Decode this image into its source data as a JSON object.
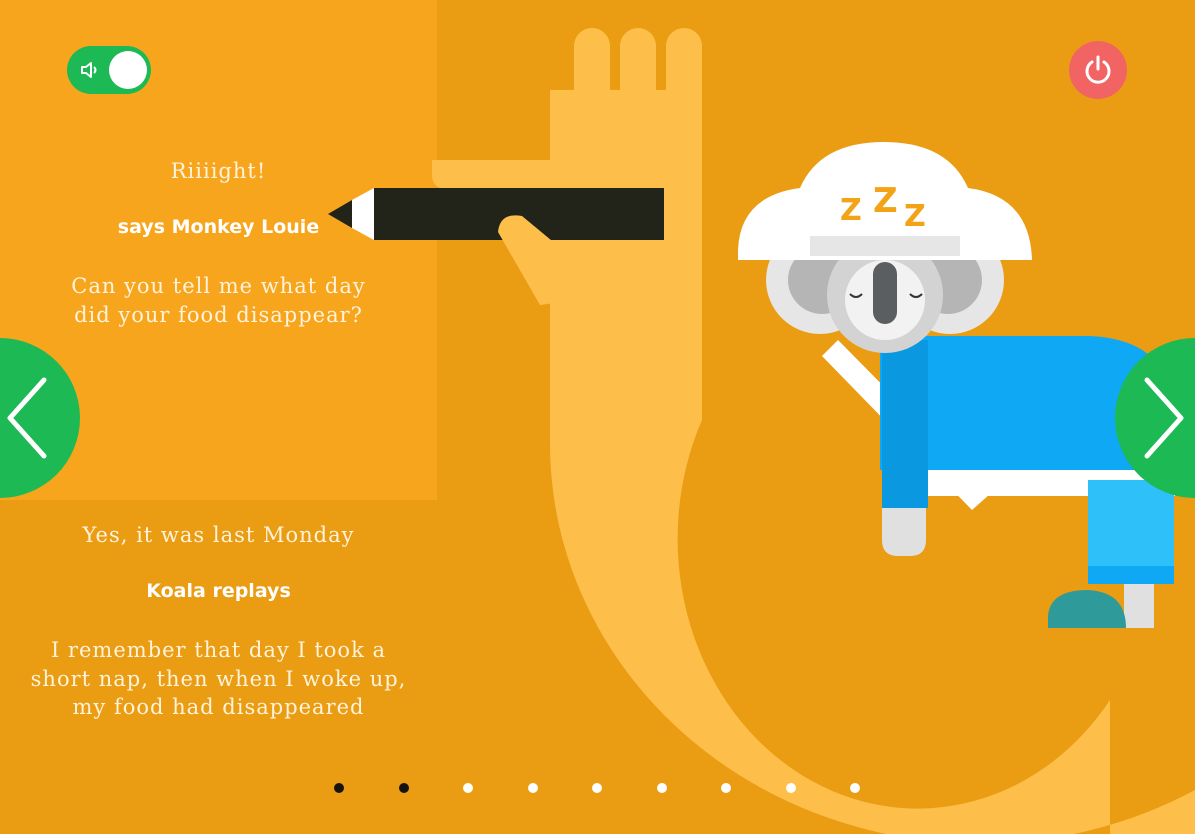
{
  "colors": {
    "background": "#EA9C13",
    "panel": "#F8A51E",
    "accent_green": "#1DB954",
    "power_red": "#F26464",
    "arm": "#FDBF4A",
    "shirt": "#0FA8F5",
    "active_dot": "#16130E"
  },
  "sound_toggle": {
    "icon": "speaker-icon",
    "state": "on"
  },
  "power_button": {
    "icon": "power-icon"
  },
  "monkey": {
    "quote": "Riiiight!",
    "speaker": "says Monkey Louie",
    "question_line1": "Can you tell me what day",
    "question_line2": "did your food disappear?"
  },
  "koala": {
    "answer": "Yes, it was last Monday",
    "speaker": "Koala replays",
    "story_line1": "I remember that day I took a",
    "story_line2": "short nap, then when I woke up,",
    "story_line3": "my food had disappeared"
  },
  "navigation": {
    "prev_icon": "chevron-left-icon",
    "next_icon": "chevron-right-icon"
  },
  "pagination": {
    "total": 9,
    "current": 2
  }
}
